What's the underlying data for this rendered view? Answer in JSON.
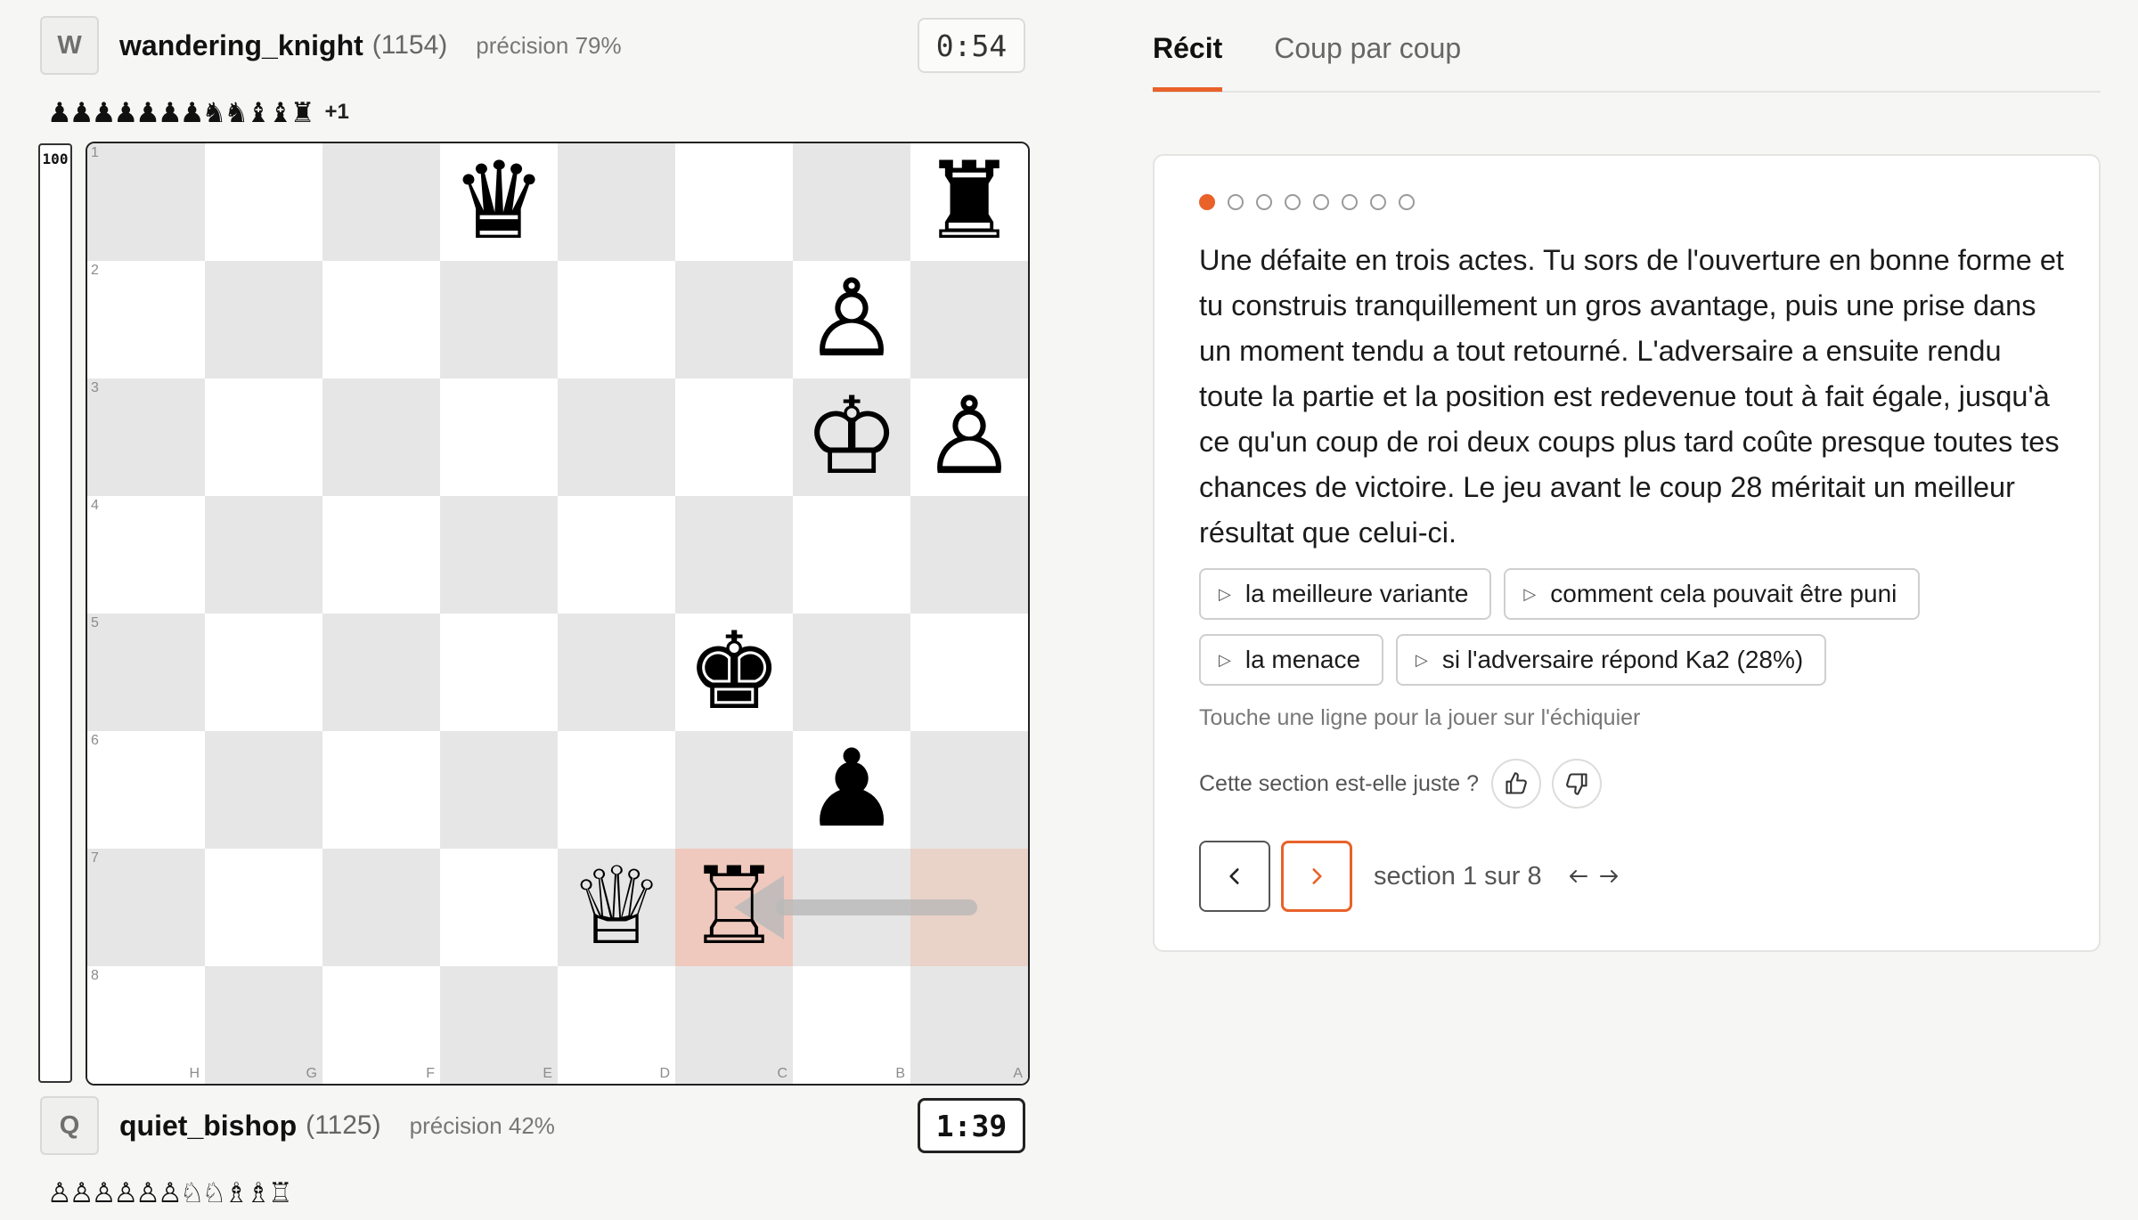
{
  "top_player": {
    "initial": "W",
    "name": "wandering_knight",
    "rating": "(1154)",
    "accuracy": "précision 79%",
    "clock": "0:54",
    "captured": "♟♟♟♟♟♟♟♞♞♝♝♜",
    "material_adv": "+1"
  },
  "bottom_player": {
    "initial": "Q",
    "name": "quiet_bishop",
    "rating": "(1125)",
    "accuracy": "précision 42%",
    "clock": "1:39",
    "captured": "♙♙♙♙♙♙♘♘♗♗♖"
  },
  "eval": {
    "label": "100",
    "white_fraction": 1.0
  },
  "board": {
    "orientation": "black",
    "rank_labels": [
      "1",
      "2",
      "3",
      "4",
      "5",
      "6",
      "7",
      "8"
    ],
    "file_labels": [
      "H",
      "G",
      "F",
      "E",
      "D",
      "C",
      "B",
      "A"
    ],
    "pieces": [
      {
        "square": "e1",
        "glyph": "♛",
        "name": "black-queen"
      },
      {
        "square": "a1",
        "glyph": "♜",
        "name": "black-rook"
      },
      {
        "square": "b2",
        "glyph": "♙",
        "name": "white-pawn"
      },
      {
        "square": "b3",
        "glyph": "♔",
        "name": "white-king"
      },
      {
        "square": "a3",
        "glyph": "♙",
        "name": "white-pawn"
      },
      {
        "square": "c5",
        "glyph": "♚",
        "name": "black-king"
      },
      {
        "square": "b6",
        "glyph": "♟",
        "name": "black-pawn"
      },
      {
        "square": "d7",
        "glyph": "♕",
        "name": "white-queen"
      },
      {
        "square": "c7",
        "glyph": "♖",
        "name": "white-rook"
      }
    ],
    "last_move": {
      "from": "a7",
      "to": "c7"
    },
    "arrow": {
      "from": "a7",
      "to": "c7",
      "color": "#b9b9b9"
    }
  },
  "tabs": [
    {
      "label": "Récit",
      "active": true
    },
    {
      "label": "Coup par coup",
      "active": false
    }
  ],
  "story": {
    "section_count": 8,
    "current_section": 1,
    "text": "Une défaite en trois actes. Tu sors de l'ouverture en bonne forme et tu construis tranquillement un gros avantage, puis une prise dans un moment tendu a tout retourné. L'adversaire a ensuite rendu toute la partie et la position est redevenue tout à fait égale, jusqu'à ce qu'un coup de roi deux coups plus tard coûte presque toutes tes chances de victoire. Le jeu avant le coup 28 méritait un meilleur résultat que celui-ci.",
    "chips": [
      "la meilleure variante",
      "comment cela pouvait être puni",
      "la menace",
      "si l'adversaire répond Ka2 (28%)"
    ],
    "hint": "Touche une ligne pour la jouer sur l'échiquier",
    "feedback_question": "Cette section est-elle juste ?",
    "section_label": "section 1 sur 8"
  },
  "colors": {
    "accent": "#e8622a",
    "light_square": "#ffffff",
    "dark_square": "#e6e6e6",
    "last_move_highlight": "#efc9bd"
  },
  "icons": {
    "chip": "play-triangle-icon",
    "thumbs_up": "thumbs-up-icon",
    "thumbs_down": "thumbs-down-icon",
    "prev": "chevron-left-icon",
    "next": "chevron-right-icon",
    "keys": "arrow-keys-icon"
  }
}
